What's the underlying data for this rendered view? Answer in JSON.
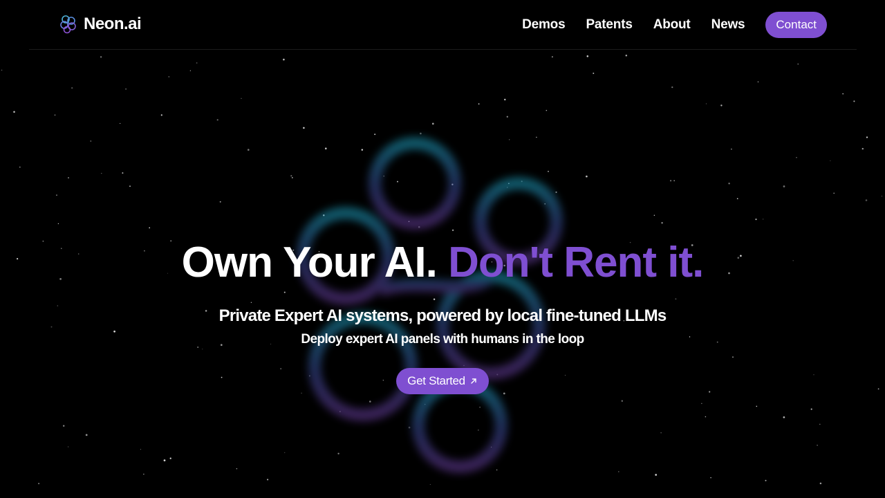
{
  "brand": {
    "name": "Neon.ai",
    "icon": "brain-icon",
    "colors": {
      "accent": "#7f4fd1",
      "glow_cyan": "#1fa3c2",
      "glow_purple": "#6a3fa0"
    }
  },
  "nav": {
    "items": [
      {
        "label": "Demos"
      },
      {
        "label": "Patents"
      },
      {
        "label": "About"
      },
      {
        "label": "News"
      }
    ],
    "contact_label": "Contact"
  },
  "hero": {
    "title_plain": "Own Your AI.",
    "title_accent": "Don't Rent it.",
    "subtitle": "Private Expert AI systems, powered by local fine-tuned LLMs",
    "subtitle2": "Deploy expert AI panels with humans in the loop",
    "cta_label": "Get Started",
    "cta_icon": "arrow-up-right-icon"
  }
}
